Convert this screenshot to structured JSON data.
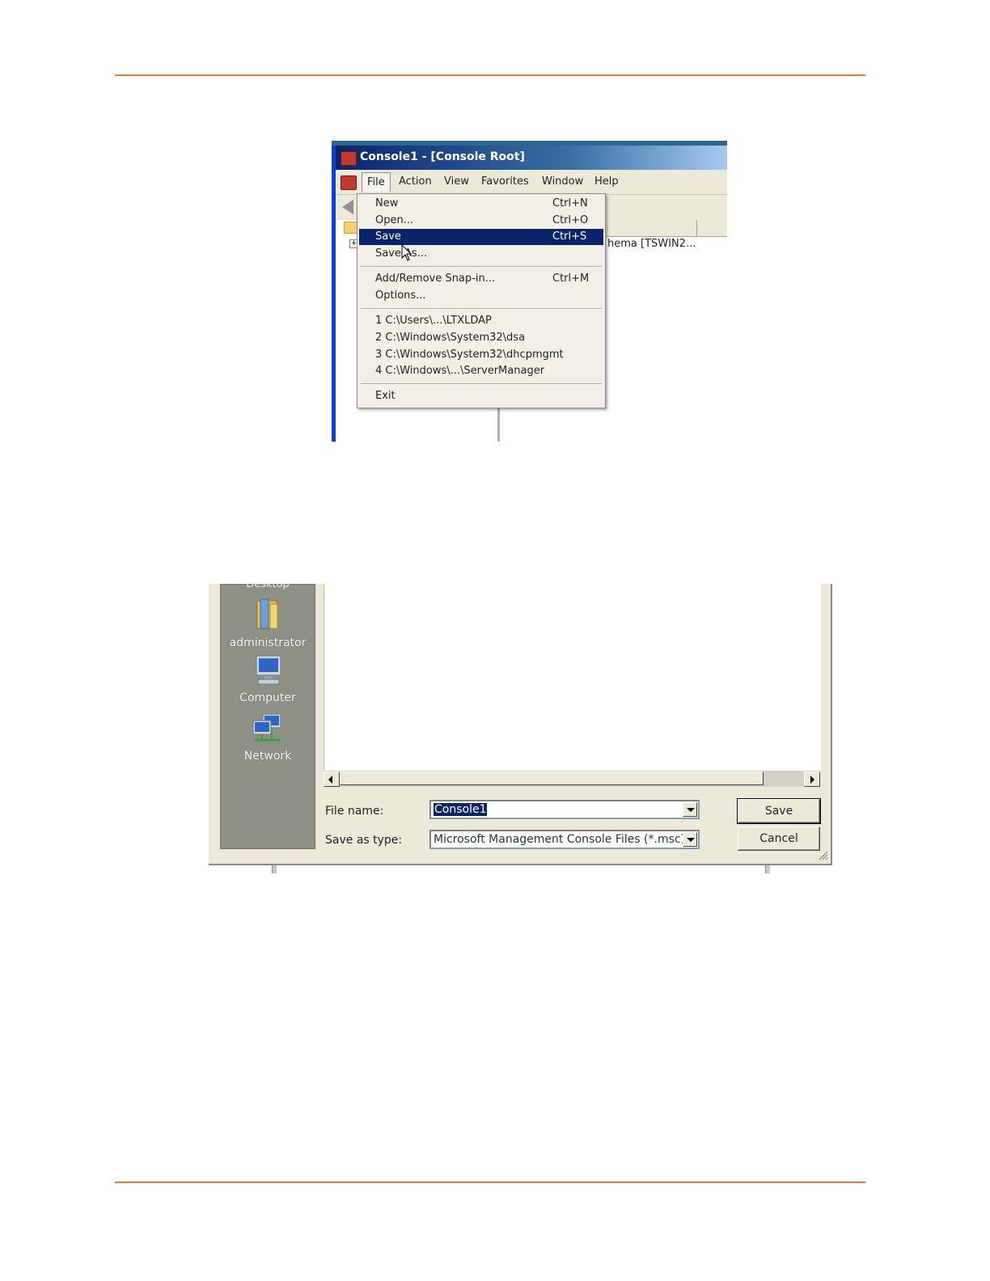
{
  "mmc": {
    "title": "Console1 - [Console Root]",
    "menu": [
      "File",
      "Action",
      "View",
      "Favorites",
      "Window",
      "Help"
    ],
    "tree_text": "hema [TSWIN2...",
    "expander": "+",
    "file_menu": {
      "items": [
        {
          "label": "New",
          "shortcut": "Ctrl+N"
        },
        {
          "label": "Open...",
          "shortcut": "Ctrl+O"
        },
        {
          "label": "Save",
          "shortcut": "Ctrl+S"
        },
        {
          "label": "Save As...",
          "shortcut": ""
        },
        {
          "label": "Add/Remove Snap-in...",
          "shortcut": "Ctrl+M"
        },
        {
          "label": "Options...",
          "shortcut": ""
        },
        {
          "label": "1 C:\\Users\\...\\LTXLDAP",
          "shortcut": ""
        },
        {
          "label": "2 C:\\Windows\\System32\\dsa",
          "shortcut": ""
        },
        {
          "label": "3 C:\\Windows\\System32\\dhcpmgmt",
          "shortcut": ""
        },
        {
          "label": "4 C:\\Windows\\...\\ServerManager",
          "shortcut": ""
        },
        {
          "label": "Exit",
          "shortcut": ""
        }
      ],
      "selected_index": 2
    }
  },
  "save_dialog": {
    "places_cut_label": "Desktop",
    "places": [
      "administrator",
      "Computer",
      "Network"
    ],
    "file_name_label": "File name:",
    "file_name_value": "Console1",
    "save_as_type_label": "Save as type:",
    "save_as_type_value": "Microsoft Management Console Files (*.msc)",
    "save_button": "Save",
    "cancel_button": "Cancel"
  },
  "colors": {
    "rule": "#e07a2e",
    "menu_selection": "#0a246a",
    "places_bar": "#8e9086"
  }
}
